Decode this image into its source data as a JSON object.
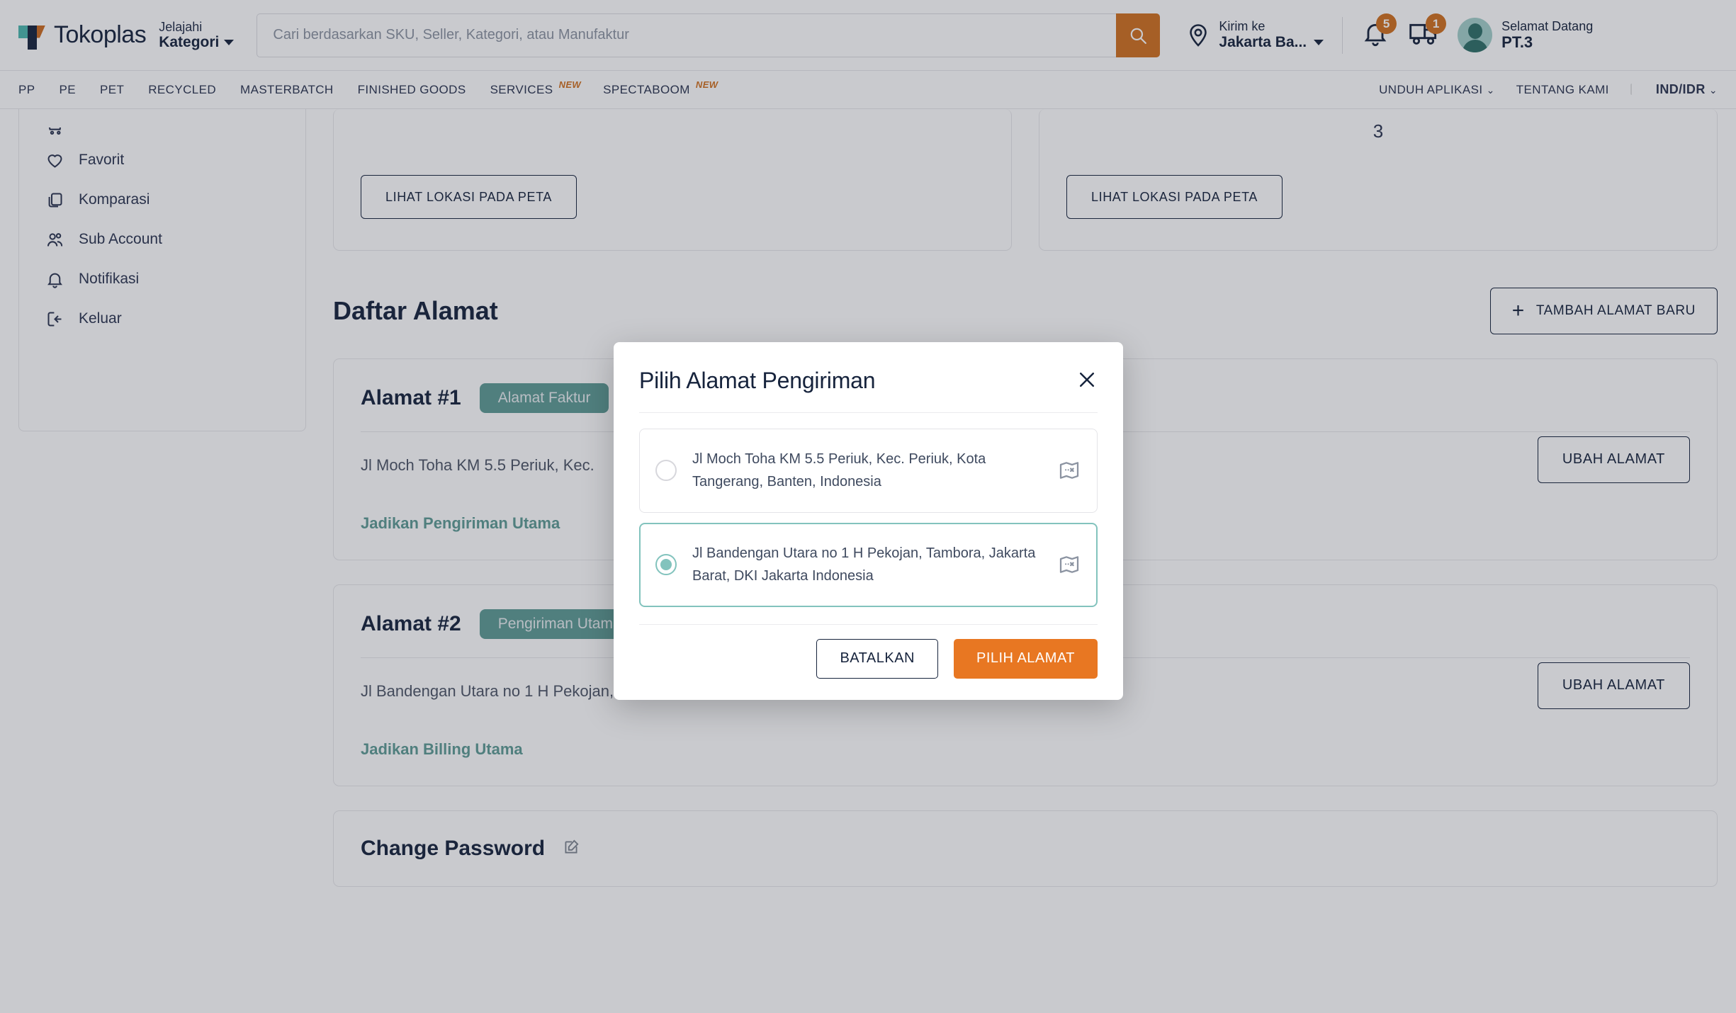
{
  "header": {
    "brand": "Tokoplas",
    "category_small": "Jelajahi",
    "category_big": "Kategori",
    "search_placeholder": "Cari berdasarkan SKU, Seller, Kategori, atau Manufaktur",
    "search_value": "",
    "ship_to_label": "Kirim ke",
    "ship_to_value": "Jakarta Ba...",
    "notification_count": "5",
    "delivery_count": "1",
    "welcome_label": "Selamat Datang",
    "account_name": "PT.3"
  },
  "nav": {
    "items": [
      {
        "label": "PP",
        "tag": ""
      },
      {
        "label": "PE",
        "tag": ""
      },
      {
        "label": "PET",
        "tag": ""
      },
      {
        "label": "RECYCLED",
        "tag": ""
      },
      {
        "label": "MASTERBATCH",
        "tag": ""
      },
      {
        "label": "FINISHED GOODS",
        "tag": ""
      },
      {
        "label": "SERVICES",
        "tag": "NEW"
      },
      {
        "label": "SPECTABOOM",
        "tag": "NEW"
      }
    ],
    "download_app": "UNDUH APLIKASI",
    "about_us": "TENTANG KAMI",
    "language": "IND/IDR"
  },
  "sidebar": {
    "items": [
      {
        "label": "Favorit",
        "icon": "heart-icon"
      },
      {
        "label": "Komparasi",
        "icon": "copy-icon"
      },
      {
        "label": "Sub Account",
        "icon": "users-icon"
      },
      {
        "label": "Notifikasi",
        "icon": "bell-icon"
      },
      {
        "label": "Keluar",
        "icon": "logout-icon"
      }
    ]
  },
  "main": {
    "cards": [
      {
        "number": "",
        "map_button": "LIHAT LOKASI PADA PETA"
      },
      {
        "number": "3",
        "map_button": "LIHAT LOKASI PADA PETA"
      }
    ],
    "section_title": "Daftar Alamat",
    "add_address_button": "TAMBAH ALAMAT BARU",
    "addresses": [
      {
        "title": "Alamat #1",
        "badge": "Alamat Faktur",
        "address": "Jl Moch Toha KM 5.5 Periuk, Kec.",
        "link": "Jadikan Pengiriman Utama",
        "action": "UBAH ALAMAT"
      },
      {
        "title": "Alamat #2",
        "badge": "Pengiriman Utama",
        "address": "Jl Bandengan Utara no 1 H Pekojan, Tambora, Jakarta Barat, DKI Jakarta Indonesia",
        "link": "Jadikan Billing Utama",
        "action": "UBAH ALAMAT"
      }
    ],
    "change_password_title": "Change Password"
  },
  "modal": {
    "title": "Pilih Alamat Pengiriman",
    "options": [
      {
        "text": "Jl Moch Toha KM 5.5 Periuk, Kec. Periuk, Kota Tangerang, Banten, Indonesia",
        "selected": false
      },
      {
        "text": "Jl Bandengan Utara no 1 H Pekojan, Tambora, Jakarta Barat, DKI Jakarta Indonesia",
        "selected": true
      }
    ],
    "cancel_label": "BATALKAN",
    "confirm_label": "PILIH ALAMAT"
  },
  "colors": {
    "accent_orange": "#e87722",
    "brand_orange": "#d1711f",
    "teal": "#82c3bd",
    "badge_teal": "#5e9b95",
    "navy": "#16233c"
  }
}
